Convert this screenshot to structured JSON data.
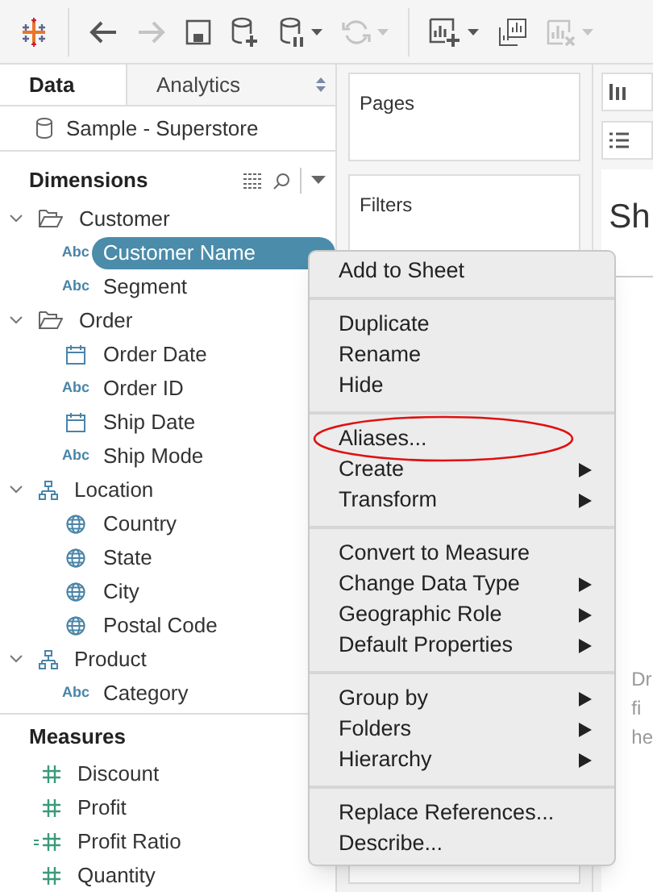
{
  "toolbar": [
    {
      "kind": "logo"
    },
    {
      "kind": "back",
      "disabled": false
    },
    {
      "kind": "forward",
      "disabled": true
    },
    {
      "kind": "save",
      "disabled": false
    },
    {
      "kind": "new-datasource",
      "disabled": false
    },
    {
      "kind": "pause",
      "disabled": false
    },
    {
      "kind": "caret",
      "disabled": false
    },
    {
      "kind": "refresh",
      "disabled": true
    },
    {
      "kind": "caret",
      "disabled": true
    },
    {
      "kind": "new-sheet",
      "disabled": false
    },
    {
      "kind": "caret",
      "disabled": false
    },
    {
      "kind": "duplicate-sheet",
      "disabled": false
    },
    {
      "kind": "clear-sheet",
      "disabled": true
    },
    {
      "kind": "caret",
      "disabled": true
    }
  ],
  "pane_tabs": [
    {
      "label": "Data",
      "selected": true
    },
    {
      "label": "Analytics",
      "selected": false
    }
  ],
  "datasource": "Sample - Superstore",
  "dimensions": {
    "title": "Dimensions",
    "groups": [
      {
        "label": "Customer",
        "kind": "folder",
        "expanded": true,
        "children": [
          {
            "label": "Customer Name",
            "kind": "abc",
            "badge": "Abc",
            "selected": true
          },
          {
            "label": "Segment",
            "kind": "abc",
            "badge": "Abc",
            "selected": false
          }
        ]
      },
      {
        "label": "Order",
        "kind": "folder",
        "expanded": true,
        "children": [
          {
            "label": "Order Date",
            "kind": "date",
            "selected": false
          },
          {
            "label": "Order ID",
            "kind": "abc",
            "badge": "Abc",
            "selected": false
          },
          {
            "label": "Ship Date",
            "kind": "date",
            "selected": false
          },
          {
            "label": "Ship Mode",
            "kind": "abc",
            "badge": "Abc",
            "selected": false
          }
        ]
      },
      {
        "label": "Location",
        "kind": "hierarchy",
        "expanded": true,
        "children": [
          {
            "label": "Country",
            "kind": "geo",
            "selected": false
          },
          {
            "label": "State",
            "kind": "geo",
            "selected": false
          },
          {
            "label": "City",
            "kind": "geo",
            "selected": false
          },
          {
            "label": "Postal Code",
            "kind": "geo",
            "selected": false
          }
        ]
      },
      {
        "label": "Product",
        "kind": "hierarchy",
        "expanded": true,
        "children": [
          {
            "label": "Category",
            "kind": "abc",
            "badge": "Abc",
            "selected": false
          }
        ]
      }
    ]
  },
  "measures": {
    "title": "Measures",
    "items": [
      {
        "label": "Discount",
        "kind": "number"
      },
      {
        "label": "Profit",
        "kind": "number"
      },
      {
        "label": "Profit Ratio",
        "kind": "calc"
      },
      {
        "label": "Quantity",
        "kind": "number"
      }
    ]
  },
  "shelves": [
    {
      "title": "Pages"
    },
    {
      "title": "Filters"
    }
  ],
  "sheet_title": "Sh",
  "drop_hint": [
    "Dr",
    "fi",
    "he"
  ],
  "context_menu": [
    [
      {
        "label": "Add to Sheet",
        "submenu": false,
        "circled": false
      }
    ],
    [
      {
        "label": "Duplicate",
        "submenu": false,
        "circled": false
      },
      {
        "label": "Rename",
        "submenu": false,
        "circled": false
      },
      {
        "label": "Hide",
        "submenu": false,
        "circled": false
      }
    ],
    [
      {
        "label": "Aliases...",
        "submenu": false,
        "circled": true
      },
      {
        "label": "Create",
        "submenu": true,
        "circled": false
      },
      {
        "label": "Transform",
        "submenu": true,
        "circled": false
      }
    ],
    [
      {
        "label": "Convert to Measure",
        "submenu": false,
        "circled": false
      },
      {
        "label": "Change Data Type",
        "submenu": true,
        "circled": false
      },
      {
        "label": "Geographic Role",
        "submenu": true,
        "circled": false
      },
      {
        "label": "Default Properties",
        "submenu": true,
        "circled": false
      }
    ],
    [
      {
        "label": "Group by",
        "submenu": true,
        "circled": false
      },
      {
        "label": "Folders",
        "submenu": true,
        "circled": false
      },
      {
        "label": "Hierarchy",
        "submenu": true,
        "circled": false
      }
    ],
    [
      {
        "label": "Replace References...",
        "submenu": false,
        "circled": false
      },
      {
        "label": "Describe...",
        "submenu": false,
        "circled": false
      }
    ]
  ]
}
